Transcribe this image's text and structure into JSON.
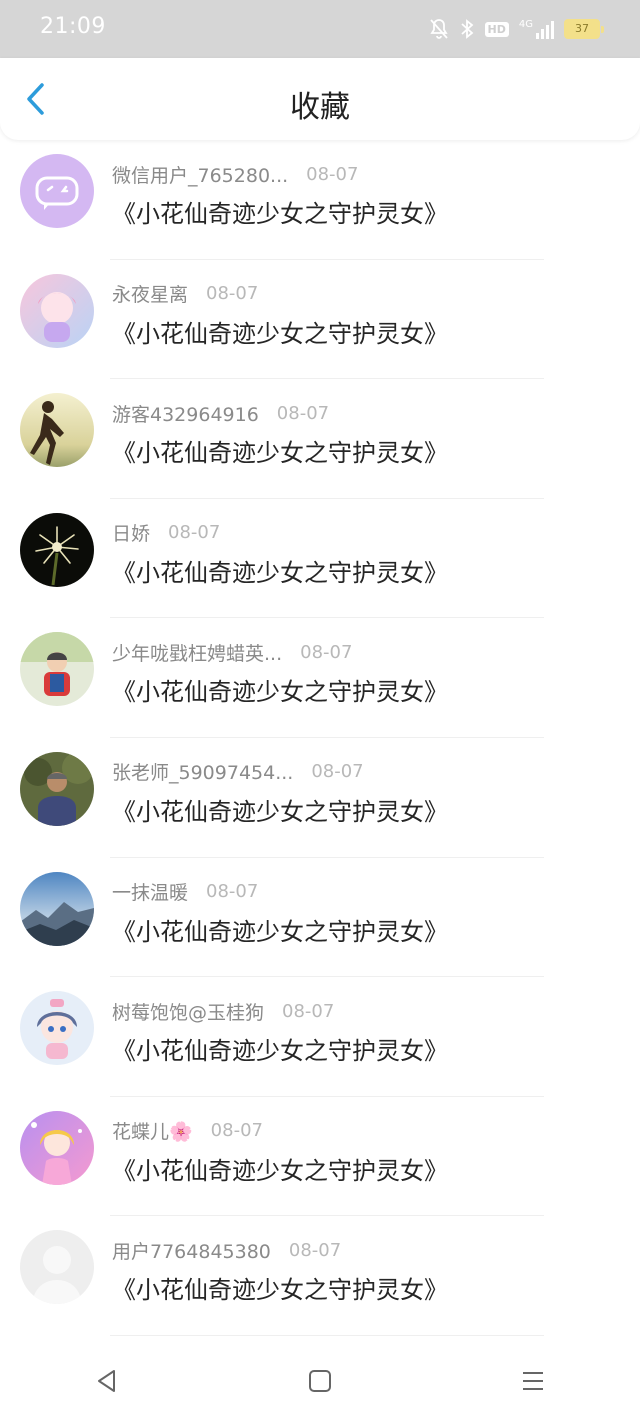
{
  "status": {
    "time": "21:09",
    "battery": "37",
    "network": "4G",
    "hd": "HD"
  },
  "header": {
    "title": "收藏",
    "back_icon": "chevron-left-icon",
    "accent": "#2d9cdb"
  },
  "favorites": [
    {
      "user": "微信用户_765280...",
      "date": "08-07",
      "title": "《小花仙奇迹少女之守护灵女》",
      "avatar": "chat-bubble"
    },
    {
      "user": "永夜星离",
      "date": "08-07",
      "title": "《小花仙奇迹少女之守护灵女》",
      "avatar": "anime-girl-pink"
    },
    {
      "user": "游客432964916",
      "date": "08-07",
      "title": "《小花仙奇迹少女之守护灵女》",
      "avatar": "silhouette-sunset"
    },
    {
      "user": "日娇",
      "date": "08-07",
      "title": "《小花仙奇迹少女之守护灵女》",
      "avatar": "night-flower"
    },
    {
      "user": "少年咙戥枉娉蜡英...",
      "date": "08-07",
      "title": "《小花仙奇迹少女之守护灵女》",
      "avatar": "child-photo"
    },
    {
      "user": "张老师_59097454...",
      "date": "08-07",
      "title": "《小花仙奇迹少女之守护灵女》",
      "avatar": "man-photo"
    },
    {
      "user": "一抹温暖",
      "date": "08-07",
      "title": "《小花仙奇迹少女之守护灵女》",
      "avatar": "mountain-landscape"
    },
    {
      "user": "树莓饱饱@玉桂狗",
      "date": "08-07",
      "title": "《小花仙奇迹少女之守护灵女》",
      "avatar": "anime-girl-blue"
    },
    {
      "user": "花蝶儿🌸",
      "date": "08-07",
      "title": "《小花仙奇迹少女之守护灵女》",
      "avatar": "anime-girl-purple"
    },
    {
      "user": "用户7764845380",
      "date": "08-07",
      "title": "《小花仙奇迹少女之守护灵女》",
      "avatar": "default-user"
    }
  ],
  "bottom_nav": [
    "back-triangle-icon",
    "home-square-icon",
    "menu-lines-icon"
  ]
}
